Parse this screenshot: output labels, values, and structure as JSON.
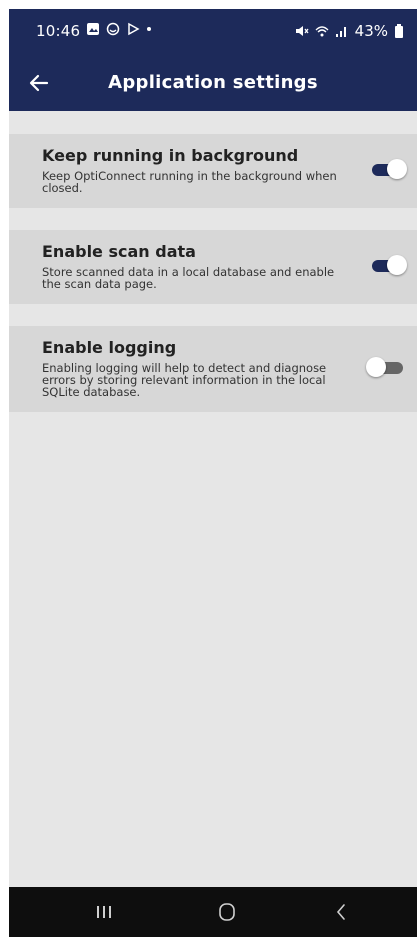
{
  "status_bar": {
    "time": "10:46",
    "battery": "43%",
    "left_icons": [
      "gallery-icon",
      "face-icon",
      "play-icon",
      "dot-icon"
    ],
    "right_icons": [
      "mute-icon",
      "wifi-icon",
      "signal-icon",
      "battery-icon"
    ]
  },
  "app_bar": {
    "title": "Application settings",
    "back_icon": "arrow-left-icon",
    "color": "#1d2a5a"
  },
  "settings": [
    {
      "title": "Keep running in background",
      "description": "Keep OptiConnect running in the background when closed.",
      "enabled": true
    },
    {
      "title": "Enable scan data",
      "description": "Store scanned data in a local database and enable the scan data page.",
      "enabled": true
    },
    {
      "title": "Enable logging",
      "description": "Enabling logging will help to detect and diagnose errors by storing relevant information in the local SQLite database.",
      "enabled": false
    }
  ],
  "toggle_colors": {
    "on_track": "#1d2a5a",
    "off_track": "#666666",
    "thumb": "#ffffff"
  },
  "nav_bar": {
    "buttons": [
      "recent-apps-icon",
      "home-icon",
      "back-icon"
    ]
  }
}
